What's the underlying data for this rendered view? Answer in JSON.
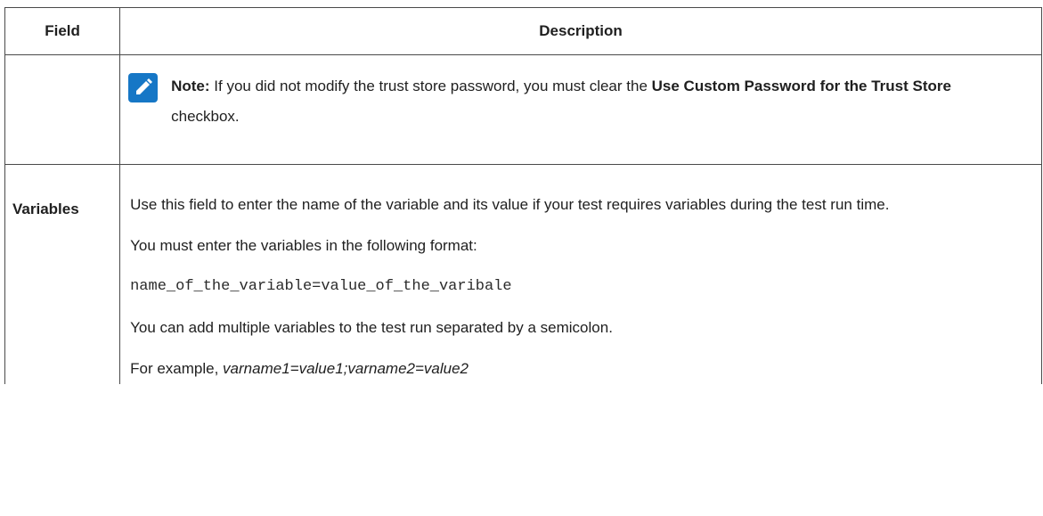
{
  "table": {
    "headers": {
      "field": "Field",
      "description": "Description"
    },
    "note_row": {
      "icon": "pencil-icon",
      "icon_color": "#1677c6",
      "label": "Note:",
      "text_before": " If you did not modify the trust store password, you must clear the ",
      "bold_term": "Use Custom Password for the Trust Store",
      "text_after": " checkbox."
    },
    "variables_row": {
      "field": "Variables",
      "p1": "Use this field to enter the name of the variable and its value if your test requires variables during the test run time.",
      "p2": "You must enter the variables in the following format:",
      "code": "name_of_the_variable=value_of_the_varibale",
      "p3": "You can add multiple variables to the test run separated by a semicolon.",
      "example_prefix": "For example, ",
      "example_value": "varname1=value1;varname2=value2"
    }
  }
}
